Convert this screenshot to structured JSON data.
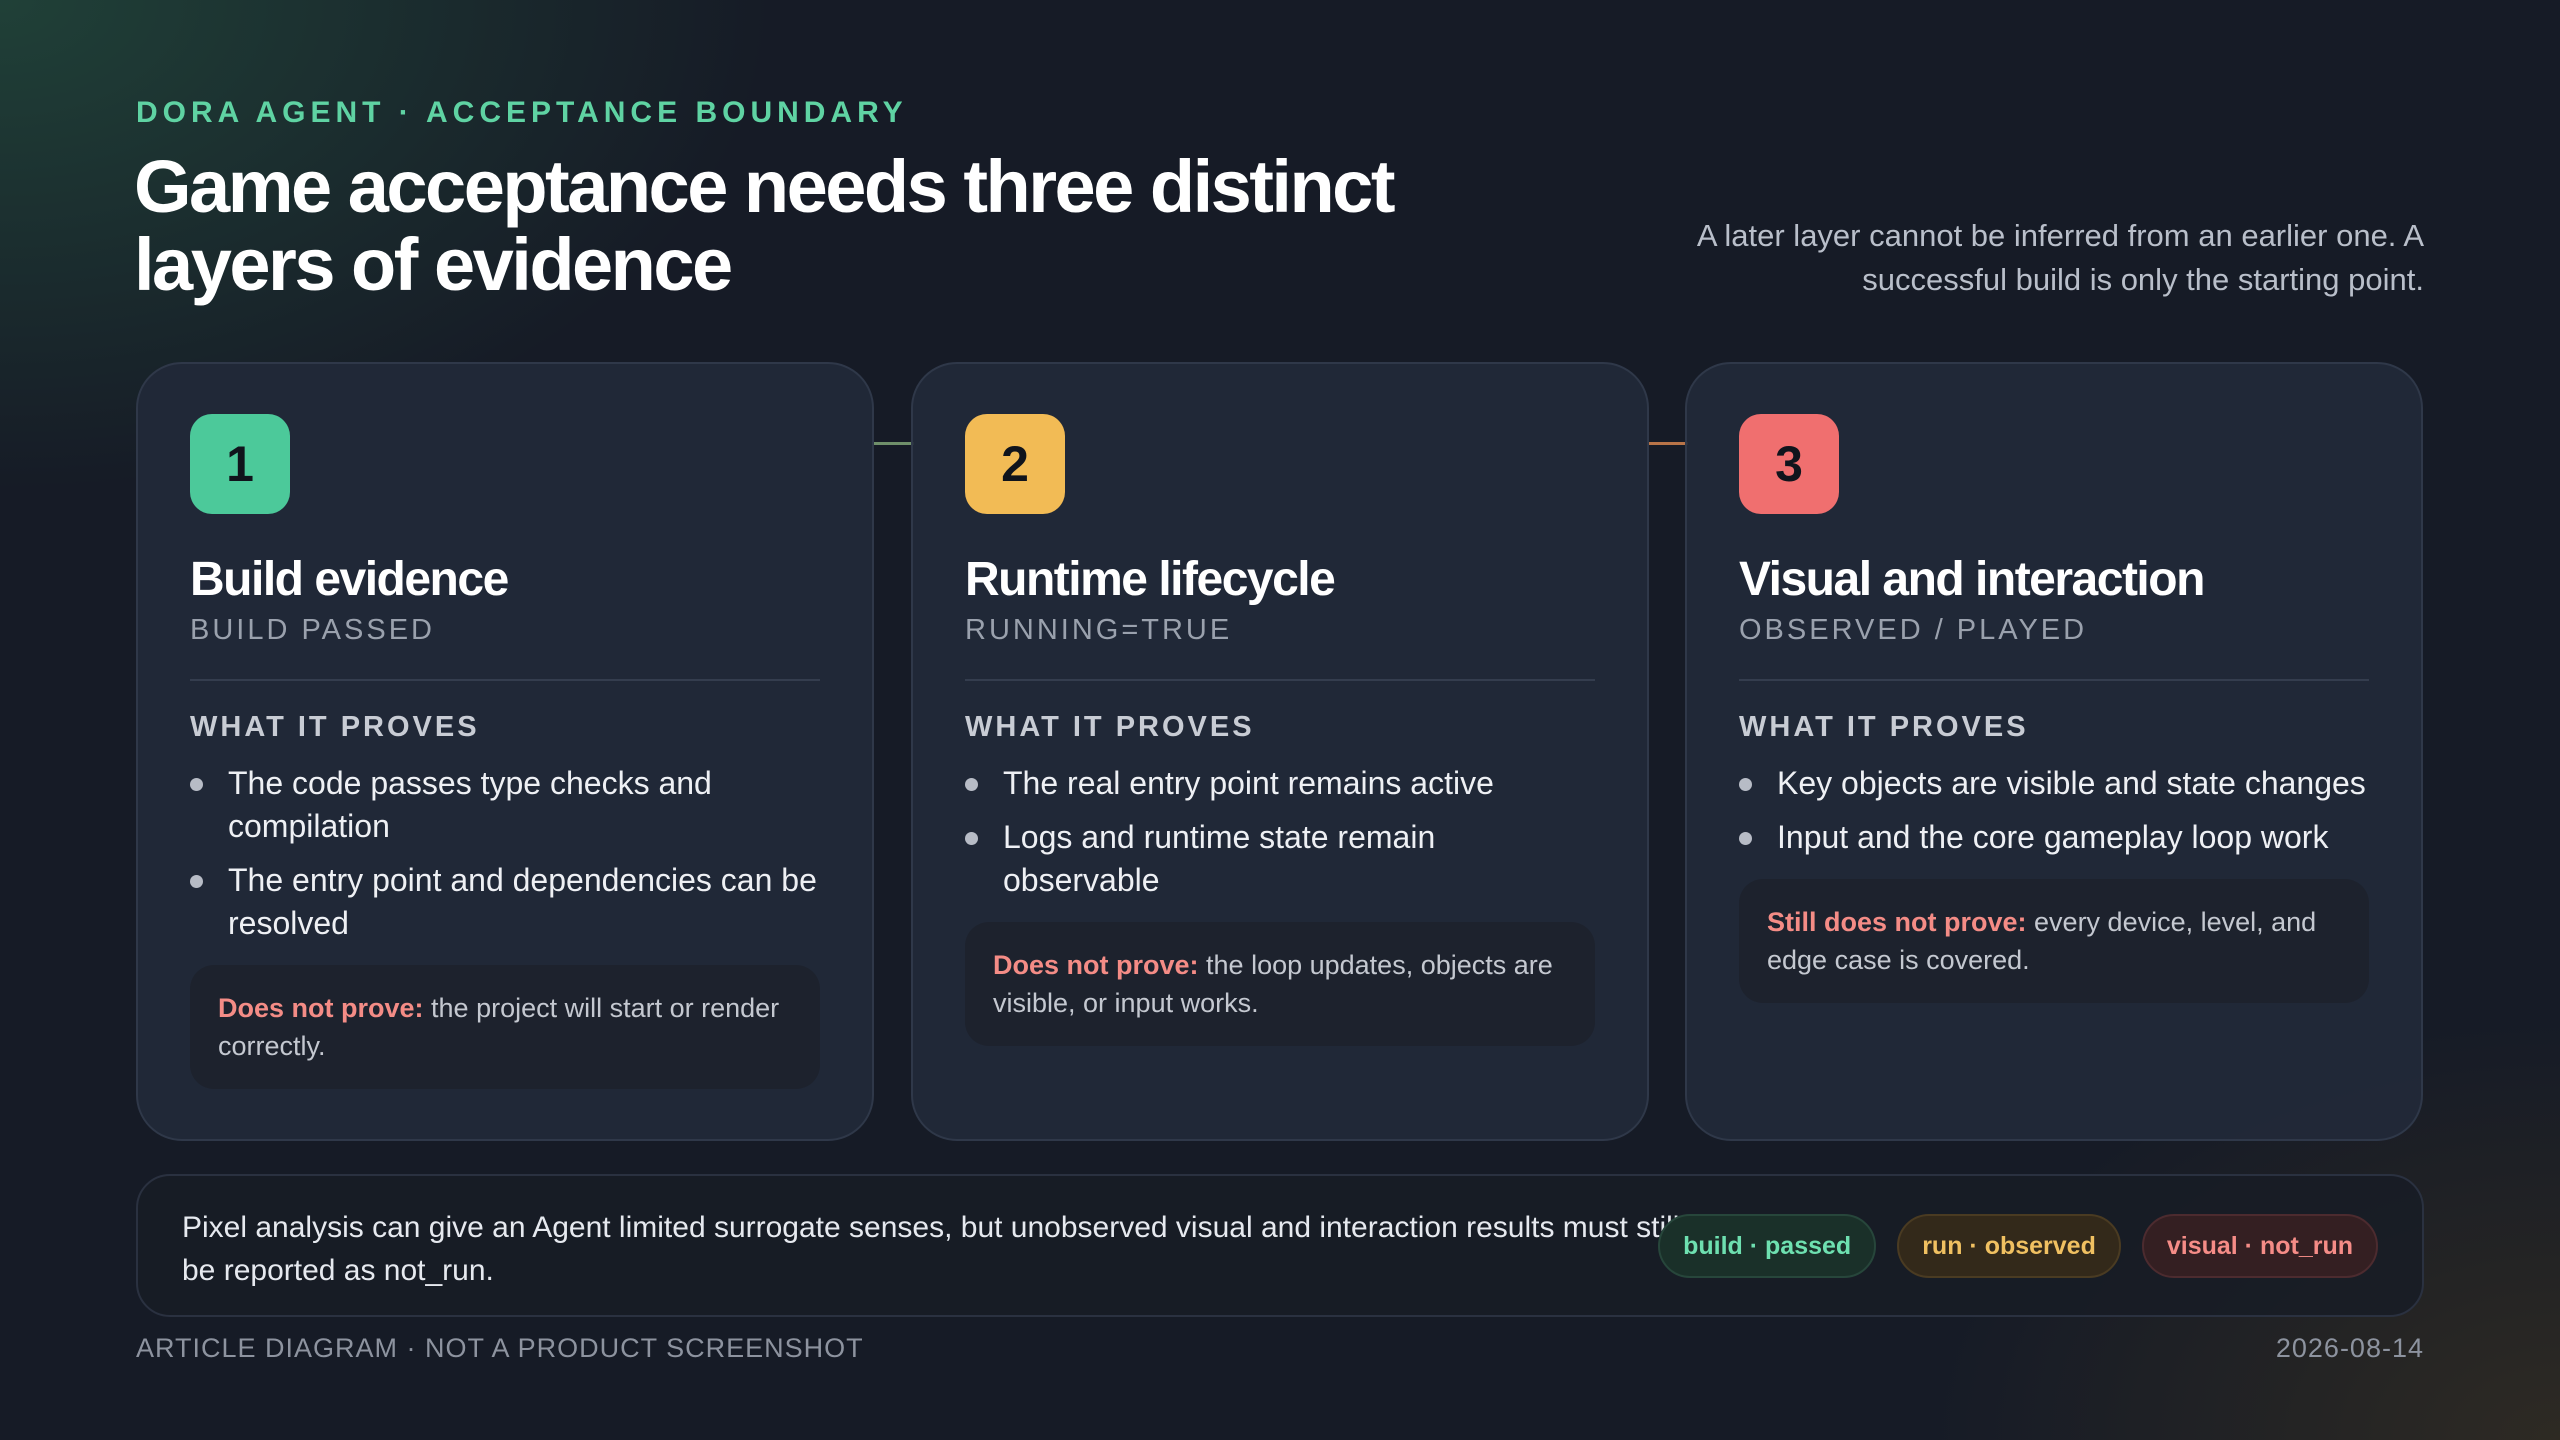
{
  "header": {
    "eyebrow": "DORA AGENT · ACCEPTANCE BOUNDARY",
    "title": "Game acceptance needs three distinct layers of evidence",
    "lede": "A later layer cannot be inferred from an earlier one. A successful build is only the starting point."
  },
  "cards": [
    {
      "number": "1",
      "color": "#4cc99a",
      "title": "Build evidence",
      "subtitle": "BUILD PASSED",
      "proves_heading": "WHAT IT PROVES",
      "bullets": [
        "The code passes type checks and compilation",
        "The entry point and dependencies can be resolved"
      ],
      "note_label": "Does not prove:",
      "note_text": " the project will start or render correctly."
    },
    {
      "number": "2",
      "color": "#f2bb55",
      "title": "Runtime lifecycle",
      "subtitle": "RUNNING=TRUE",
      "proves_heading": "WHAT IT PROVES",
      "bullets": [
        "The real entry point remains active",
        "Logs and runtime state remain observable"
      ],
      "note_label": "Does not prove:",
      "note_text": " the loop updates, objects are visible, or input works."
    },
    {
      "number": "3",
      "color": "#f06f6f",
      "title": "Visual and interaction",
      "subtitle": "OBSERVED / PLAYED",
      "proves_heading": "WHAT IT PROVES",
      "bullets": [
        "Key objects are visible and state changes",
        "Input and the core gameplay loop work"
      ],
      "note_label": "Still does not prove:",
      "note_text": " every device, level, and edge case is covered."
    }
  ],
  "banner": {
    "text": "Pixel analysis can give an Agent limited surrogate senses, but unobserved visual and interaction results must still be reported as not_run.",
    "pills": [
      {
        "label": "build · passed",
        "status_color": "#6ee0b0"
      },
      {
        "label": "run · observed",
        "status_color": "#f0c061"
      },
      {
        "label": "visual · not_run",
        "status_color": "#f58c87"
      }
    ]
  },
  "footer": {
    "left": "ARTICLE DIAGRAM · NOT A PRODUCT SCREENSHOT",
    "right": "2026-08-14"
  }
}
